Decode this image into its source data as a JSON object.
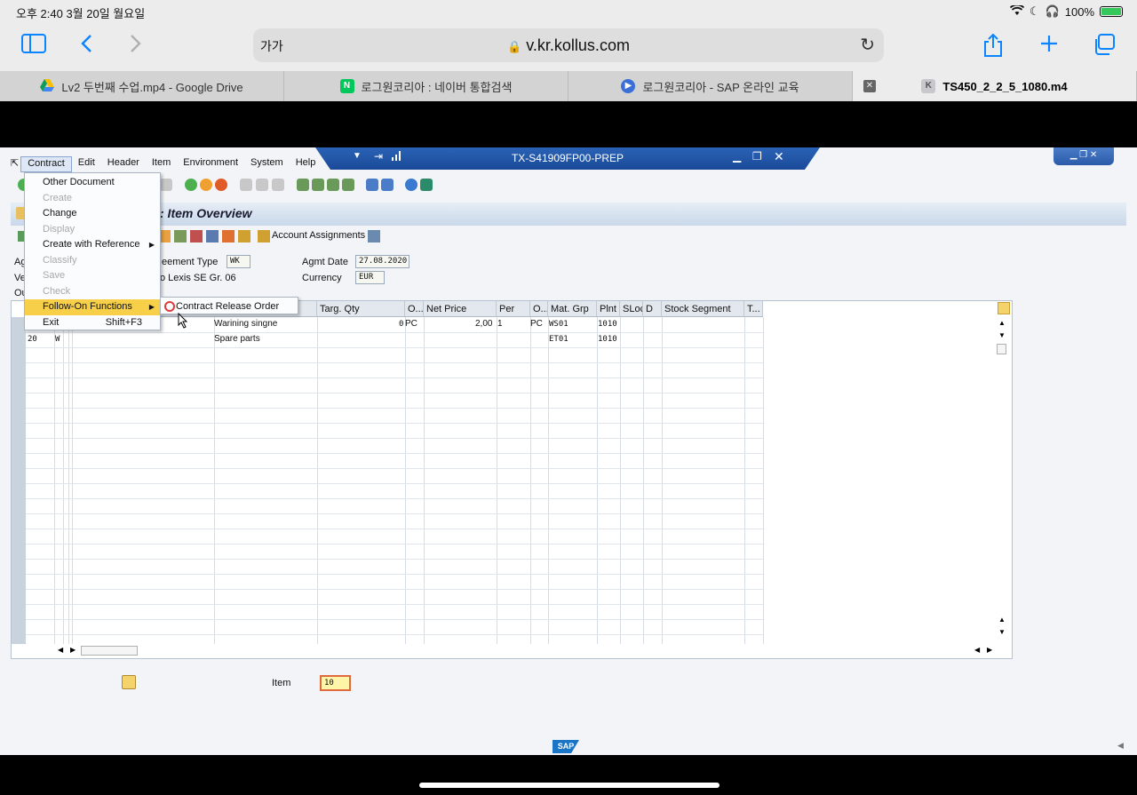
{
  "status": {
    "time_date": "오후 2:40    3월 20일 월요일",
    "battery": "100%"
  },
  "browser": {
    "aa": "가가",
    "url": "v.kr.kollus.com",
    "tabs": [
      {
        "label": "Lv2 두번째 수업.mp4 - Google Drive",
        "favicon": "google-drive-icon"
      },
      {
        "label": "로그원코리아 : 네이버 통합검색",
        "favicon": "naver-icon",
        "fav_text": "N"
      },
      {
        "label": "로그원코리아 - SAP 온라인 교육",
        "favicon": "play-icon"
      },
      {
        "label": "TS450_2_2_5_1080.m4",
        "favicon": "k-icon",
        "fav_text": "K",
        "active": true
      }
    ]
  },
  "sap": {
    "window_title": "TX-S41909FP00-PREP",
    "menu": [
      "Contract",
      "Edit",
      "Header",
      "Item",
      "Environment",
      "System",
      "Help"
    ],
    "screen_title": ": Item Overview",
    "app_toolbar": {
      "account_assignments": "Account Assignments"
    },
    "fields": {
      "agreement_type_label": "eement Type",
      "agreement_type_value": "WK",
      "agmt_date_label": "Agmt Date",
      "agmt_date_value": "27.08.2020",
      "vendor_text": "o Lexis SE Gr. 06",
      "currency_label": "Currency",
      "currency_value": "EUR",
      "cut_label_1": "Ag",
      "cut_label_2": "Ve",
      "cut_label_3": "Ou"
    },
    "grid": {
      "headers": [
        "Targ. Qty",
        "O...",
        "Net Price",
        "Per",
        "O...",
        "Mat. Grp",
        "Plnt",
        "SLoc",
        "D",
        "Stock Segment",
        "T..."
      ],
      "rows": [
        {
          "item": "",
          "cat": "",
          "short_text": "Warining singne",
          "targ_qty": "0",
          "oun": "PC",
          "net_price": "2,00",
          "per": "1",
          "opu": "PC",
          "mat_grp": "WS01",
          "plnt": "1010"
        },
        {
          "item": "20",
          "cat": "W",
          "short_text": "Spare parts",
          "targ_qty": "",
          "oun": "",
          "net_price": "",
          "per": "",
          "opu": "",
          "mat_grp": "ET01",
          "plnt": "1010"
        }
      ]
    },
    "dropdown": [
      {
        "label": "Other Document",
        "disabled": false
      },
      {
        "label": "Create",
        "disabled": true
      },
      {
        "label": "Change",
        "disabled": false
      },
      {
        "label": "Display",
        "disabled": true
      },
      {
        "label": "Create with Reference",
        "disabled": false,
        "submenu": true
      },
      {
        "label": "Classify",
        "disabled": true
      },
      {
        "label": "Save",
        "disabled": true
      },
      {
        "label": "Check",
        "disabled": true
      },
      {
        "label": "Follow-On Functions",
        "disabled": false,
        "submenu": true,
        "highlighted": true
      },
      {
        "label": "Exit",
        "disabled": false,
        "shortcut": "Shift+F3"
      }
    ],
    "submenu": {
      "label": "Contract Release Order"
    },
    "item_field": {
      "label": "Item",
      "value": "10"
    },
    "sap_logo": "SAP"
  }
}
